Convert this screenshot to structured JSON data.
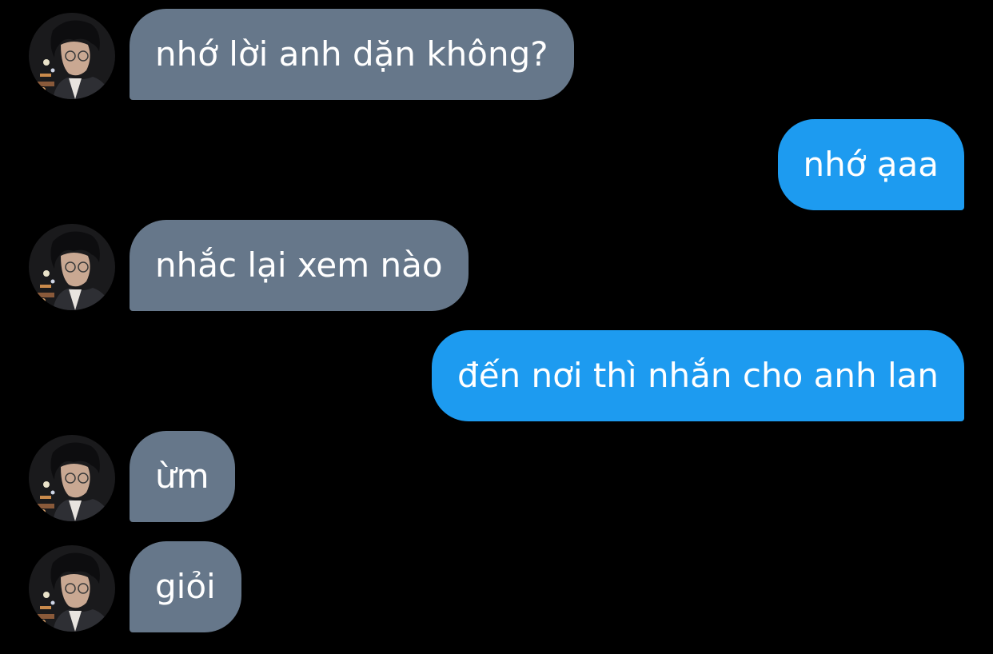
{
  "conversation": {
    "messages": [
      {
        "sender": "other",
        "text": "nhớ lời anh dặn không?"
      },
      {
        "sender": "me",
        "text": "nhớ ạaa"
      },
      {
        "sender": "other",
        "text": "nhắc lại xem nào"
      },
      {
        "sender": "me",
        "text": "đến nơi thì nhắn cho anh lan"
      },
      {
        "sender": "other",
        "text": "ừm"
      },
      {
        "sender": "other",
        "text": "giỏi"
      }
    ],
    "colors": {
      "background": "#000000",
      "incoming_bubble": "#66778a",
      "outgoing_bubble": "#1d9bf0",
      "text": "#ffffff"
    },
    "avatar_icon": "profile-photo"
  }
}
